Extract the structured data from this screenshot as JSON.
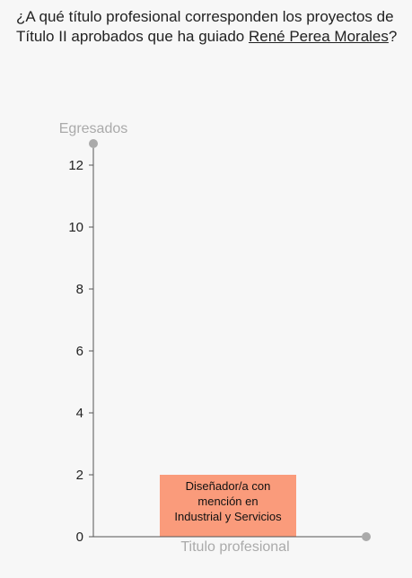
{
  "question": {
    "prefix": "¿A qué título profesional corresponden los proyectos de Título II aprobados que ha guiado ",
    "person": "René Perea Morales",
    "suffix": "?"
  },
  "chart_data": {
    "type": "bar",
    "ylabel": "Egresados",
    "xlabel": "Titulo profesional",
    "ylim": [
      0,
      13
    ],
    "y_ticks": [
      "0",
      "2",
      "4",
      "6",
      "8",
      "10",
      "12"
    ],
    "categories": [
      "Diseñador/a con mención en Industrial y Servicios"
    ],
    "category_lines": [
      [
        "Diseñador/a con",
        "mención en",
        "Industrial y Servicios"
      ]
    ],
    "values": [
      2
    ],
    "bar_color": "#fa9b7b",
    "axis_color": "#aaaaaa",
    "grid": false
  }
}
